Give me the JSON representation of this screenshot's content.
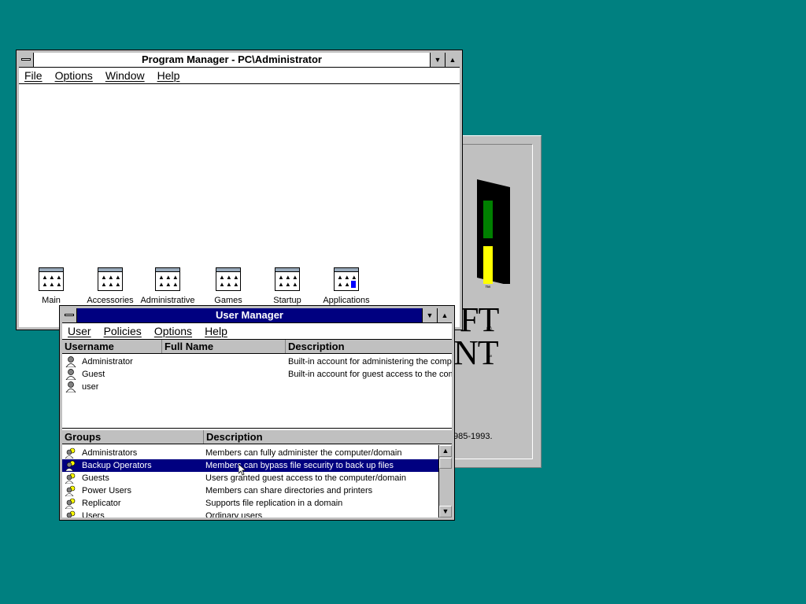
{
  "splash": {
    "text_line1": "FT",
    "text_line2": "NT",
    "trademark": "®",
    "tm": "™",
    "copyright": "985-1993."
  },
  "program_manager": {
    "title": "Program Manager - PC\\Administrator",
    "menu": [
      "File",
      "Options",
      "Window",
      "Help"
    ],
    "groups": [
      {
        "label": "Main"
      },
      {
        "label": "Accessories"
      },
      {
        "label": "Administrative"
      },
      {
        "label": "Games"
      },
      {
        "label": "Startup"
      },
      {
        "label": "Applications"
      }
    ]
  },
  "user_manager": {
    "title": "User Manager",
    "menu": [
      "User",
      "Policies",
      "Options",
      "Help"
    ],
    "users_columns": [
      "Username",
      "Full Name",
      "Description"
    ],
    "users": [
      {
        "username": "Administrator",
        "full_name": "",
        "description": "Built-in account for administering the compu"
      },
      {
        "username": "Guest",
        "full_name": "",
        "description": "Built-in account for guest access to the com"
      },
      {
        "username": "user",
        "full_name": "",
        "description": ""
      }
    ],
    "groups_columns": [
      "Groups",
      "Description"
    ],
    "groups": [
      {
        "name": "Administrators",
        "description": "Members can fully administer the computer/domain"
      },
      {
        "name": "Backup Operators",
        "description": "Members can bypass file security to back up files",
        "selected": true
      },
      {
        "name": "Guests",
        "description": "Users granted guest access to the computer/domain"
      },
      {
        "name": "Power Users",
        "description": "Members can share directories and printers"
      },
      {
        "name": "Replicator",
        "description": "Supports file replication in a domain"
      },
      {
        "name": "Users",
        "description": "Ordinary users"
      }
    ]
  },
  "colors": {
    "desktop": "#008080",
    "active_title": "#000080",
    "selection": "#000080"
  }
}
